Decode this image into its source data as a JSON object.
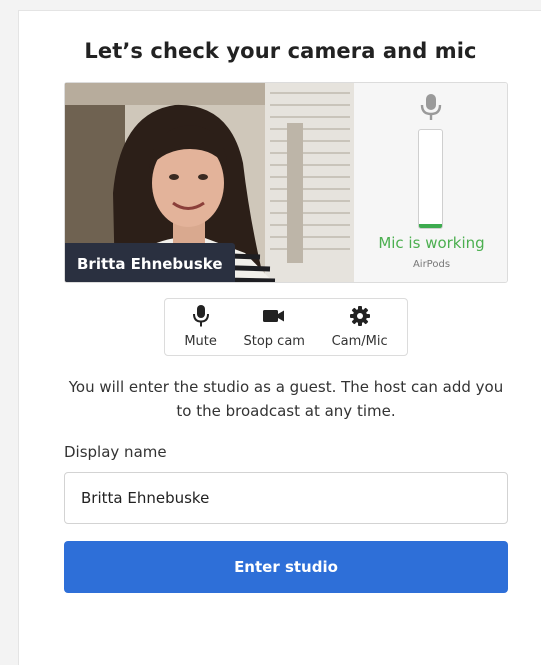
{
  "page": {
    "title": "Let’s check your camera and mic"
  },
  "preview": {
    "participant_name": "Britta Ehnebuske",
    "mic": {
      "status": "Mic is working",
      "device": "AirPods",
      "level_fraction": 0.04,
      "status_color": "#4caf50",
      "icon": "microphone-icon"
    }
  },
  "controls": [
    {
      "label": "Mute",
      "icon": "microphone-icon"
    },
    {
      "label": "Stop cam",
      "icon": "video-camera-icon"
    },
    {
      "label": "Cam/Mic",
      "icon": "gear-icon"
    }
  ],
  "info_text": "You will enter the studio as a guest. The host can add you to the broadcast at any time.",
  "display_name": {
    "label": "Display name",
    "value": "Britta Ehnebuske"
  },
  "enter_button": {
    "label": "Enter studio",
    "color": "#2e6fd8"
  }
}
